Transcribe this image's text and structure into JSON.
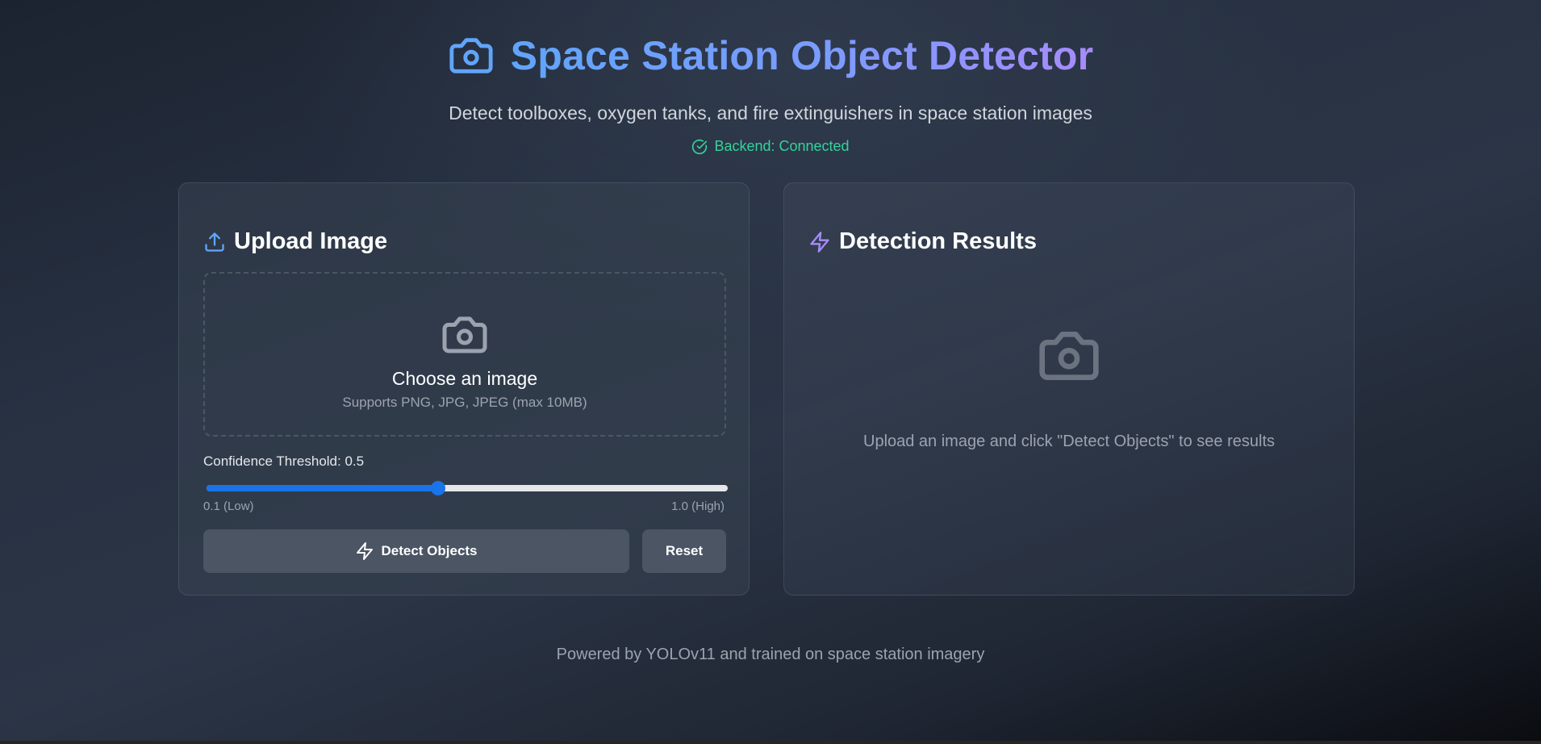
{
  "header": {
    "title": "Space Station Object Detector",
    "subtitle": "Detect toolboxes, oxygen tanks, and fire extinguishers in space station images",
    "status": "Backend: Connected",
    "title_icon": "camera-icon",
    "status_icon": "check-circle-icon"
  },
  "upload": {
    "title": "Upload Image",
    "icon": "upload-icon",
    "dropzone": {
      "icon": "camera-icon",
      "title": "Choose an image",
      "subtitle": "Supports PNG, JPG, JPEG (max 10MB)"
    },
    "threshold": {
      "label": "Confidence Threshold: 0.5",
      "value": 0.5,
      "min": 0.1,
      "max": 1.0,
      "min_label": "0.1 (Low)",
      "max_label": "1.0 (High)"
    },
    "detect_button": "Detect Objects",
    "detect_icon": "lightning-icon",
    "reset_button": "Reset"
  },
  "results": {
    "title": "Detection Results",
    "icon": "lightning-icon",
    "empty_icon": "camera-icon",
    "empty_text": "Upload an image and click \"Detect Objects\" to see results"
  },
  "footer": {
    "text": "Powered by YOLOv11 and trained on space station imagery"
  },
  "colors": {
    "accent_blue": "#60a5fa",
    "accent_purple": "#a78bfa",
    "status_green": "#34d399",
    "slider_blue": "#1a73e8"
  }
}
